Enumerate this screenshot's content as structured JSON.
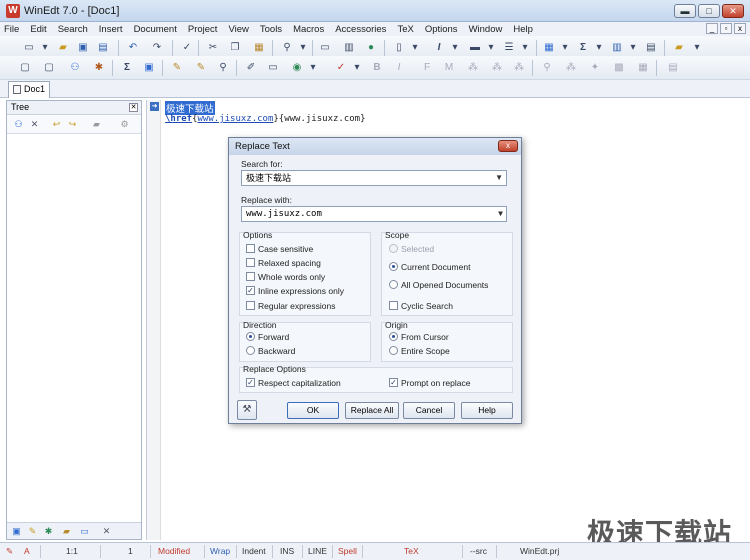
{
  "window": {
    "title": "WinEdt 7.0 - [Doc1]",
    "app_icon": "winedt-icon"
  },
  "menu": [
    "File",
    "Edit",
    "Search",
    "Insert",
    "Document",
    "Project",
    "View",
    "Tools",
    "Macros",
    "Accessories",
    "TeX",
    "Options",
    "Window",
    "Help"
  ],
  "tab": {
    "label": "Doc1"
  },
  "tree": {
    "title": "Tree"
  },
  "editor": {
    "line1": "极速下载站",
    "line2_cmd": "\\href",
    "line2_arg1": "www.jisuxz.com",
    "line2_arg2": "www.jisuxz.com"
  },
  "dialog": {
    "title": "Replace Text",
    "close": "x",
    "search_label": "Search for:",
    "search_value": "极速下载站",
    "replace_label": "Replace with:",
    "replace_value": "www.jisuxz.com",
    "options_title": "Options",
    "options": [
      {
        "label": "Case sensitive",
        "checked": false
      },
      {
        "label": "Relaxed spacing",
        "checked": false
      },
      {
        "label": "Whole words only",
        "checked": false
      },
      {
        "label": "Inline expressions only",
        "checked": true
      },
      {
        "label": "Regular expressions",
        "checked": false
      }
    ],
    "scope_title": "Scope",
    "scope": [
      {
        "label": "Selected",
        "selected": false,
        "disabled": true
      },
      {
        "label": "Current Document",
        "selected": true,
        "disabled": false
      },
      {
        "label": "All Opened Documents",
        "selected": false,
        "disabled": false
      }
    ],
    "cyclic_label": "Cyclic Search",
    "cyclic_checked": false,
    "direction_title": "Direction",
    "direction": [
      {
        "label": "Forward",
        "selected": true
      },
      {
        "label": "Backward",
        "selected": false
      }
    ],
    "origin_title": "Origin",
    "origin": [
      {
        "label": "From Cursor",
        "selected": true
      },
      {
        "label": "Entire Scope",
        "selected": false
      }
    ],
    "replace_options_title": "Replace Options",
    "respect_cap_label": "Respect capitalization",
    "respect_cap_checked": true,
    "prompt_label": "Prompt on replace",
    "prompt_checked": true,
    "buttons": {
      "ok": "OK",
      "replace_all": "Replace All",
      "cancel": "Cancel",
      "help": "Help"
    }
  },
  "status": {
    "col1": "A",
    "pos": "1:1",
    "lines": "1",
    "modified": "Modified",
    "wrap": "Wrap",
    "indent": "Indent",
    "ins": "INS",
    "line": "LINE",
    "spell": "Spell",
    "tex": "TeX",
    "src": "--src",
    "project": "WinEdt.prj"
  },
  "watermark": "极速下载站",
  "colors": {
    "accent": "#2f6bd1",
    "modified": "#c0392b",
    "keyword": "#1d4bb3"
  }
}
